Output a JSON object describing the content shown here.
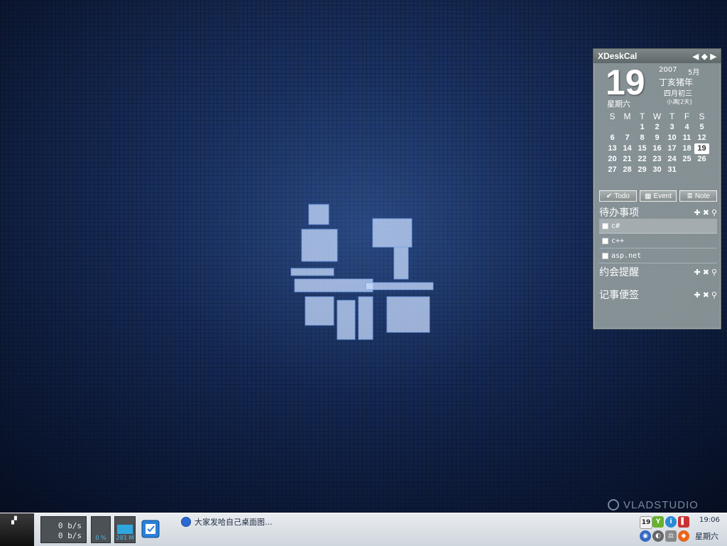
{
  "wallpaper": {
    "watermark": "VLADSTUDIO"
  },
  "xdeskcal": {
    "title": "XDeskCal",
    "day": "19",
    "weekday": "星期六",
    "year": "2007",
    "month": "5月",
    "lunar_year": "丁亥猪年",
    "lunar_date": "四月初三",
    "solar_term": "小满[2天]",
    "weekday_headers": [
      "S",
      "M",
      "T",
      "W",
      "T",
      "F",
      "S"
    ],
    "weeks": [
      [
        "",
        "",
        "1",
        "2",
        "3",
        "4",
        "5"
      ],
      [
        "6",
        "7",
        "8",
        "9",
        "10",
        "11",
        "12"
      ],
      [
        "13",
        "14",
        "15",
        "16",
        "17",
        "18",
        "19"
      ],
      [
        "20",
        "21",
        "22",
        "23",
        "24",
        "25",
        "26"
      ],
      [
        "27",
        "28",
        "29",
        "30",
        "31",
        "",
        ""
      ]
    ],
    "today": "19",
    "tabs": {
      "todo": "Todo",
      "event": "Event",
      "note": "Note"
    },
    "todo": {
      "title": "待办事项",
      "items": [
        "c#",
        "c++",
        "asp.net"
      ]
    },
    "appointment": {
      "title": "约会提醒"
    },
    "memo": {
      "title": "记事便签"
    }
  },
  "taskbar": {
    "net_down": "0 b/s",
    "net_up": "0 b/s",
    "cpu_label": "0 %",
    "mem_label": "281 M",
    "mem_fraction": 0.55,
    "task_label": "大家发哈自己桌面图...",
    "tray_calendar_day": "19",
    "time": "19:06",
    "weekday": "星期六"
  }
}
